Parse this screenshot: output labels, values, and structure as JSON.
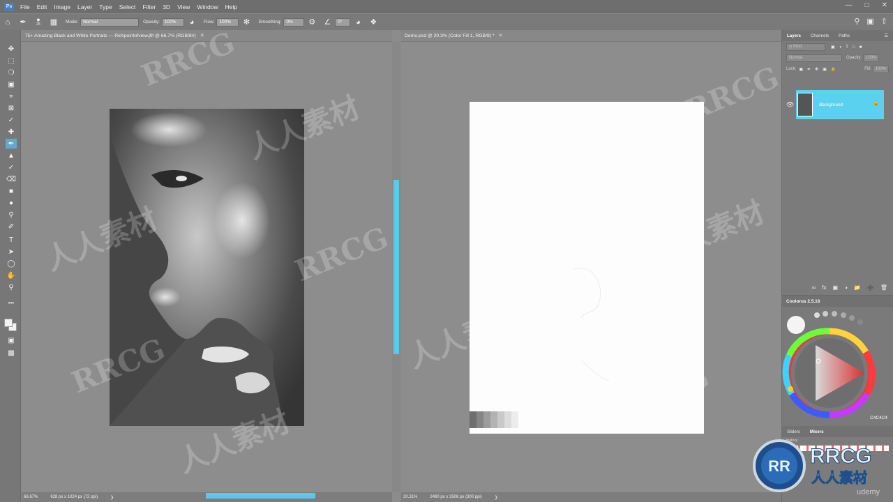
{
  "menu": {
    "app_icon": "Ps",
    "items": [
      "File",
      "Edit",
      "Image",
      "Layer",
      "Type",
      "Select",
      "Filter",
      "3D",
      "View",
      "Window",
      "Help"
    ]
  },
  "options": {
    "brush_size": "25",
    "mode_label": "Mode:",
    "mode_value": "Normal",
    "opacity_label": "Opacity:",
    "opacity_value": "100%",
    "flow_label": "Flow:",
    "flow_value": "100%",
    "smoothing_label": "Smoothing:",
    "smoothing_value": "0%",
    "angle_value": "0°"
  },
  "doc_left": {
    "tab_title": "75+ Amazing Black and White Portraits — Richpointofview.jfif @ 66.7% (RGB/8#)",
    "zoom": "66.67%",
    "dimensions": "628 px x 1024 px (72 ppi)"
  },
  "doc_right": {
    "tab_title": "Demo.psd @ 20.3% (Color Fill 1, RGB/8) *",
    "zoom": "20.31%",
    "dimensions": "2480 px x 3508 px (300 ppi)"
  },
  "layers_panel": {
    "tabs": [
      "Layers",
      "Channels",
      "Paths"
    ],
    "search_placeholder": "Kind",
    "blend_mode": "Normal",
    "opacity_label": "Opacity:",
    "opacity_value": "100%",
    "lock_label": "Lock:",
    "fill_label": "Fill:",
    "fill_value": "100%",
    "layer_name": "Background"
  },
  "coolorus": {
    "title": "Coolorus 2.5.16",
    "hex": "C4C4C4",
    "accent": "#5ad1ee"
  },
  "sliders_panel": {
    "tabs": [
      "Sliders",
      "Mixers"
    ],
    "history_label": "history"
  },
  "watermark": {
    "latin": "RRCG",
    "cjk": "人人素材"
  },
  "branding": {
    "logo_text": "RRCG",
    "logo_sub": "人人素材",
    "udemy": "udemy"
  }
}
